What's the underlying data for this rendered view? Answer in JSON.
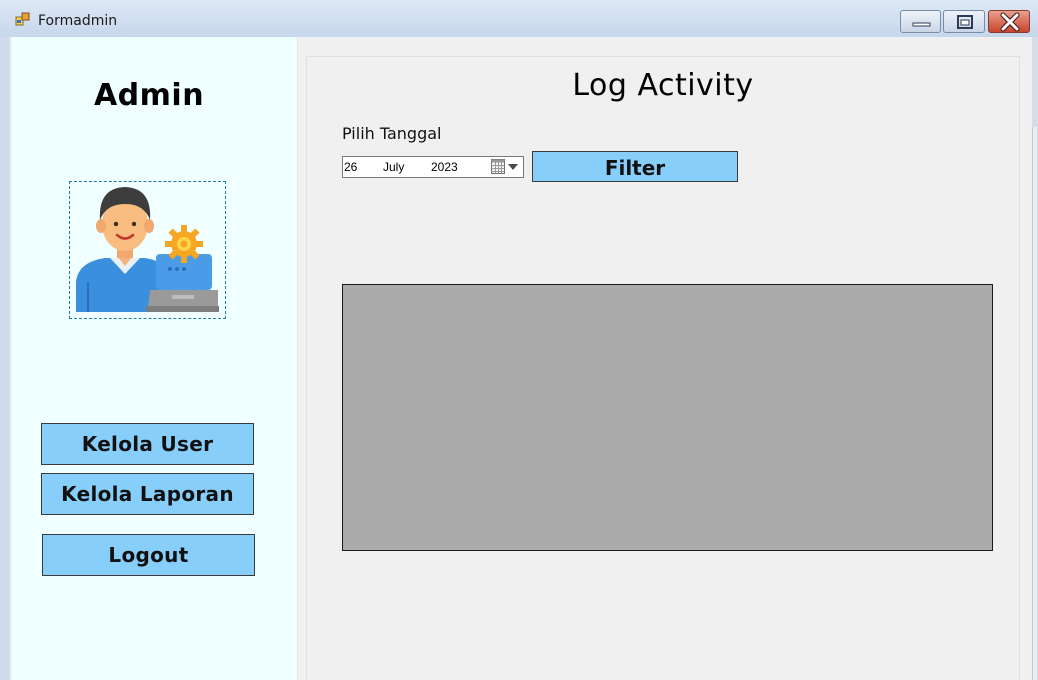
{
  "window": {
    "title": "Formadmin"
  },
  "sidebar": {
    "title": "Admin",
    "buttons": {
      "kelola_user": "Kelola User",
      "kelola_laporan": "Kelola Laporan",
      "logout": "Logout"
    }
  },
  "main": {
    "title": "Log Activity",
    "date_label": "Pilih Tanggal",
    "date": {
      "day": "26",
      "month": "July",
      "year": "2023"
    },
    "filter_label": "Filter"
  },
  "colors": {
    "sidebar_bg": "#f0ffff",
    "button_bg": "#87cefa",
    "grid_bg": "#ababab",
    "panel_bg": "#f0f0f0"
  },
  "icons": [
    "app-icon",
    "minimize-icon",
    "maximize-icon",
    "close-icon",
    "admin-avatar-icon",
    "calendar-icon",
    "dropdown-arrow-icon"
  ]
}
